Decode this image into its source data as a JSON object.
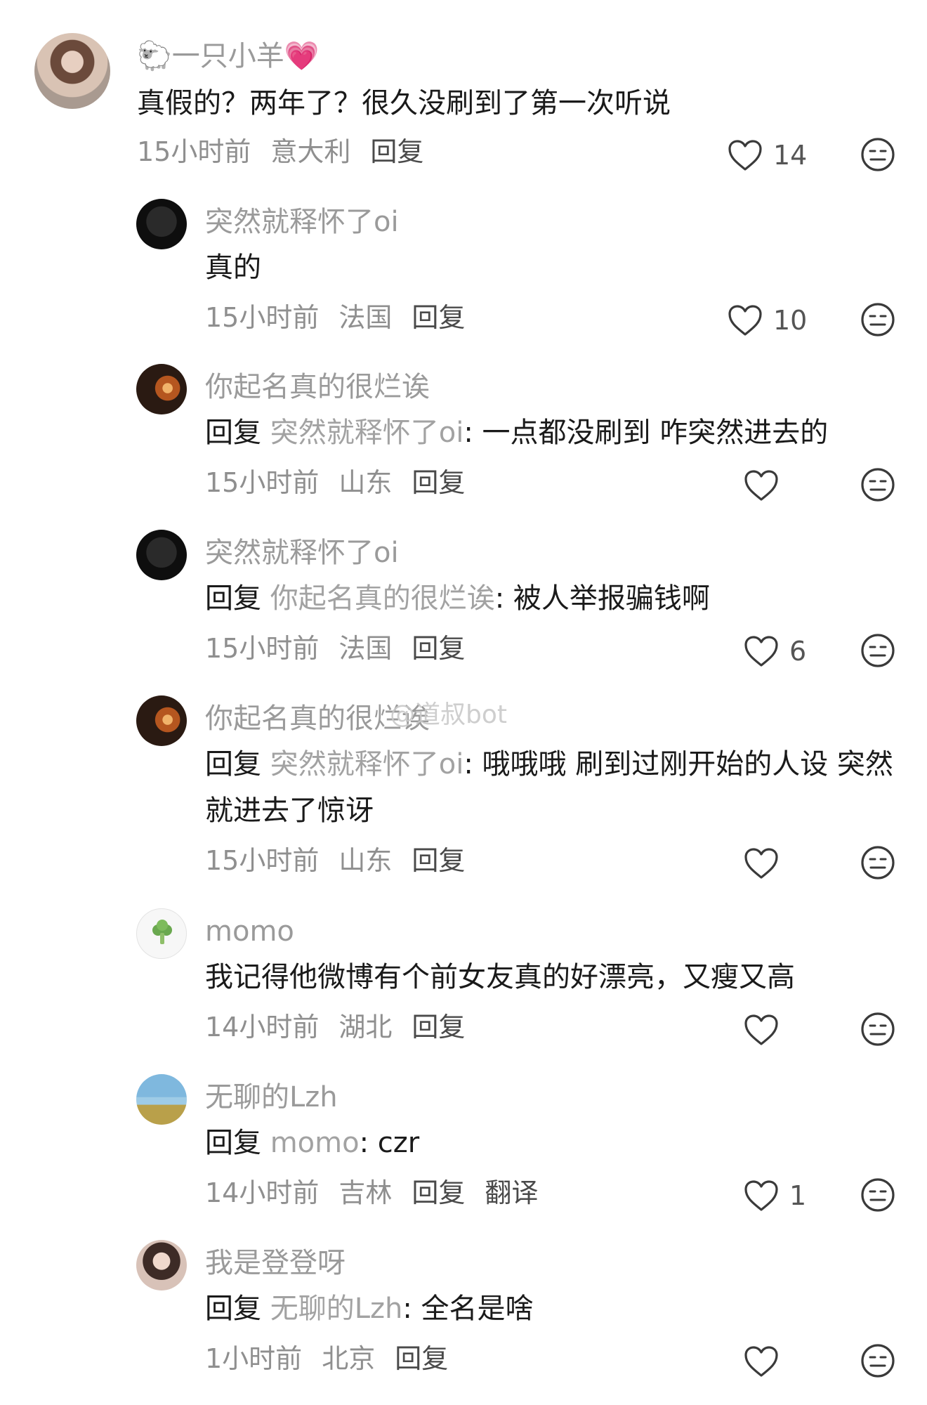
{
  "comments": [
    {
      "user": "🐑一只小羊💗",
      "text": "真假的？两年了？很久没刷到了第一次听说",
      "time": "15小时前",
      "location": "意大利",
      "reply": "回复",
      "likes": "14"
    },
    {
      "user": "突然就释怀了oi",
      "text": "真的",
      "time": "15小时前",
      "location": "法国",
      "reply": "回复",
      "likes": "10"
    },
    {
      "user": "你起名真的很烂诶",
      "reply_prefix": "回复",
      "mention": "突然就释怀了oi",
      "text": ": 一点都没刷到 咋突然进去的",
      "time": "15小时前",
      "location": "山东",
      "reply": "回复",
      "likes": ""
    },
    {
      "user": "突然就释怀了oi",
      "reply_prefix": "回复",
      "mention": "你起名真的很烂诶",
      "text": ": 被人举报骗钱啊",
      "time": "15小时前",
      "location": "法国",
      "reply": "回复",
      "likes": "6"
    },
    {
      "user": "你起名真的很烂诶",
      "reply_prefix": "回复",
      "mention": "突然就释怀了oi",
      "text": ": 哦哦哦 刷到过刚开始的人设 突然就进去了惊讶",
      "time": "15小时前",
      "location": "山东",
      "reply": "回复",
      "likes": ""
    },
    {
      "user": "momo",
      "text": "我记得他微博有个前女友真的好漂亮，又瘦又高",
      "time": "14小时前",
      "location": "湖北",
      "reply": "回复",
      "likes": ""
    },
    {
      "user": "无聊的Lzh",
      "reply_prefix": "回复",
      "mention": "momo",
      "text": ": czr",
      "time": "14小时前",
      "location": "吉林",
      "reply": "回复",
      "translate": "翻译",
      "likes": "1"
    },
    {
      "user": "我是登登呀",
      "reply_prefix": "回复",
      "mention": "无聊的Lzh",
      "text": ": 全名是啥",
      "time": "1小时前",
      "location": "北京",
      "reply": "回复",
      "likes": ""
    }
  ],
  "watermark": "@道叔bot",
  "icons": {
    "like": "heart-outline-icon",
    "dislike": "neutral-face-icon",
    "tree": "broccoli-icon"
  }
}
